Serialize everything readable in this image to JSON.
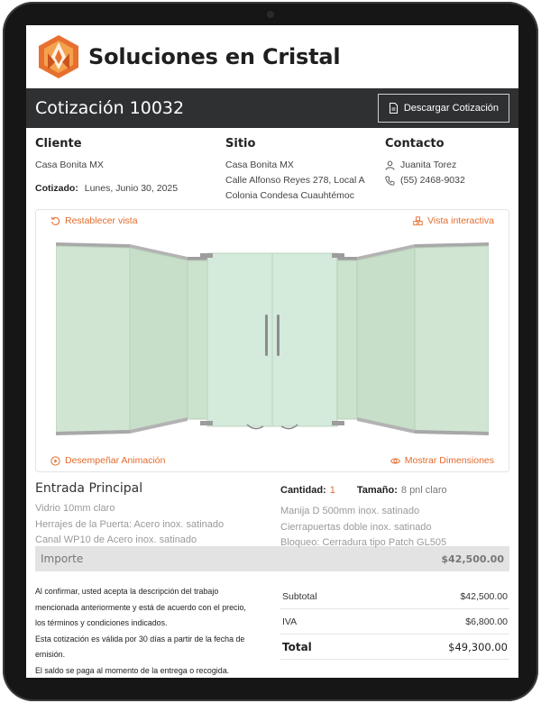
{
  "brand": {
    "name": "Soluciones en Cristal",
    "logo_icon": "logo-geometric-flame-icon",
    "accent": "#e36b2c"
  },
  "header": {
    "title": "Cotización 10032",
    "download_label": "Descargar Cotización",
    "download_icon": "document-icon"
  },
  "client": {
    "heading": "Cliente",
    "name": "Casa Bonita MX",
    "date_label": "Cotizado:",
    "date_value": "Lunes, Junio 30, 2025"
  },
  "site": {
    "heading": "Sitio",
    "lines": [
      "Casa Bonita MX",
      "Calle Alfonso Reyes 278, Local A",
      "Colonia Condesa Cuauhtémoc"
    ]
  },
  "contact": {
    "heading": "Contacto",
    "person": "Juanita Torez",
    "phone": "(55) 2468-9032",
    "person_icon": "user-icon",
    "phone_icon": "phone-icon"
  },
  "viewer": {
    "reset_label": "Restablecer vista",
    "interactive_label": "Vista interactiva",
    "play_label": "Desempeñar Animación",
    "dimensions_label": "Mostrar Dimensiones",
    "glass_color": "#d3e9d5"
  },
  "product": {
    "title": "Entrada Principal",
    "specs_left": [
      "Vidrio 10mm claro",
      "Herrajes de la Puerta: Acero inox. satinado",
      "Canal WP10 de Acero inox. satinado"
    ],
    "qty_label": "Cantidad:",
    "qty_value": "1",
    "size_label": "Tamaño:",
    "size_value": "8 pnl claro",
    "specs_right": [
      "Manija D 500mm inox. satinado",
      "Cierrapuertas doble inox. satinado",
      "Bloqueo: Cerradura tipo Patch GL505"
    ]
  },
  "importe": {
    "label": "Importe",
    "value": "$42,500.00"
  },
  "terms": {
    "lines": [
      "Al confirmar, usted acepta la descripción del trabajo",
      "mencionada anteriormente y está de acuerdo con el precio,",
      "los términos y condiciones indicados.",
      "Esta cotización es válida por 30 días a partir de la fecha de",
      "emisión.",
      "El saldo se paga al momento de la entrega o recogida."
    ]
  },
  "totals": {
    "subtotal_label": "Subtotal",
    "subtotal_value": "$42,500.00",
    "iva_label": "IVA",
    "iva_value": "$6,800.00",
    "total_label": "Total",
    "total_value": "$49,300.00"
  }
}
